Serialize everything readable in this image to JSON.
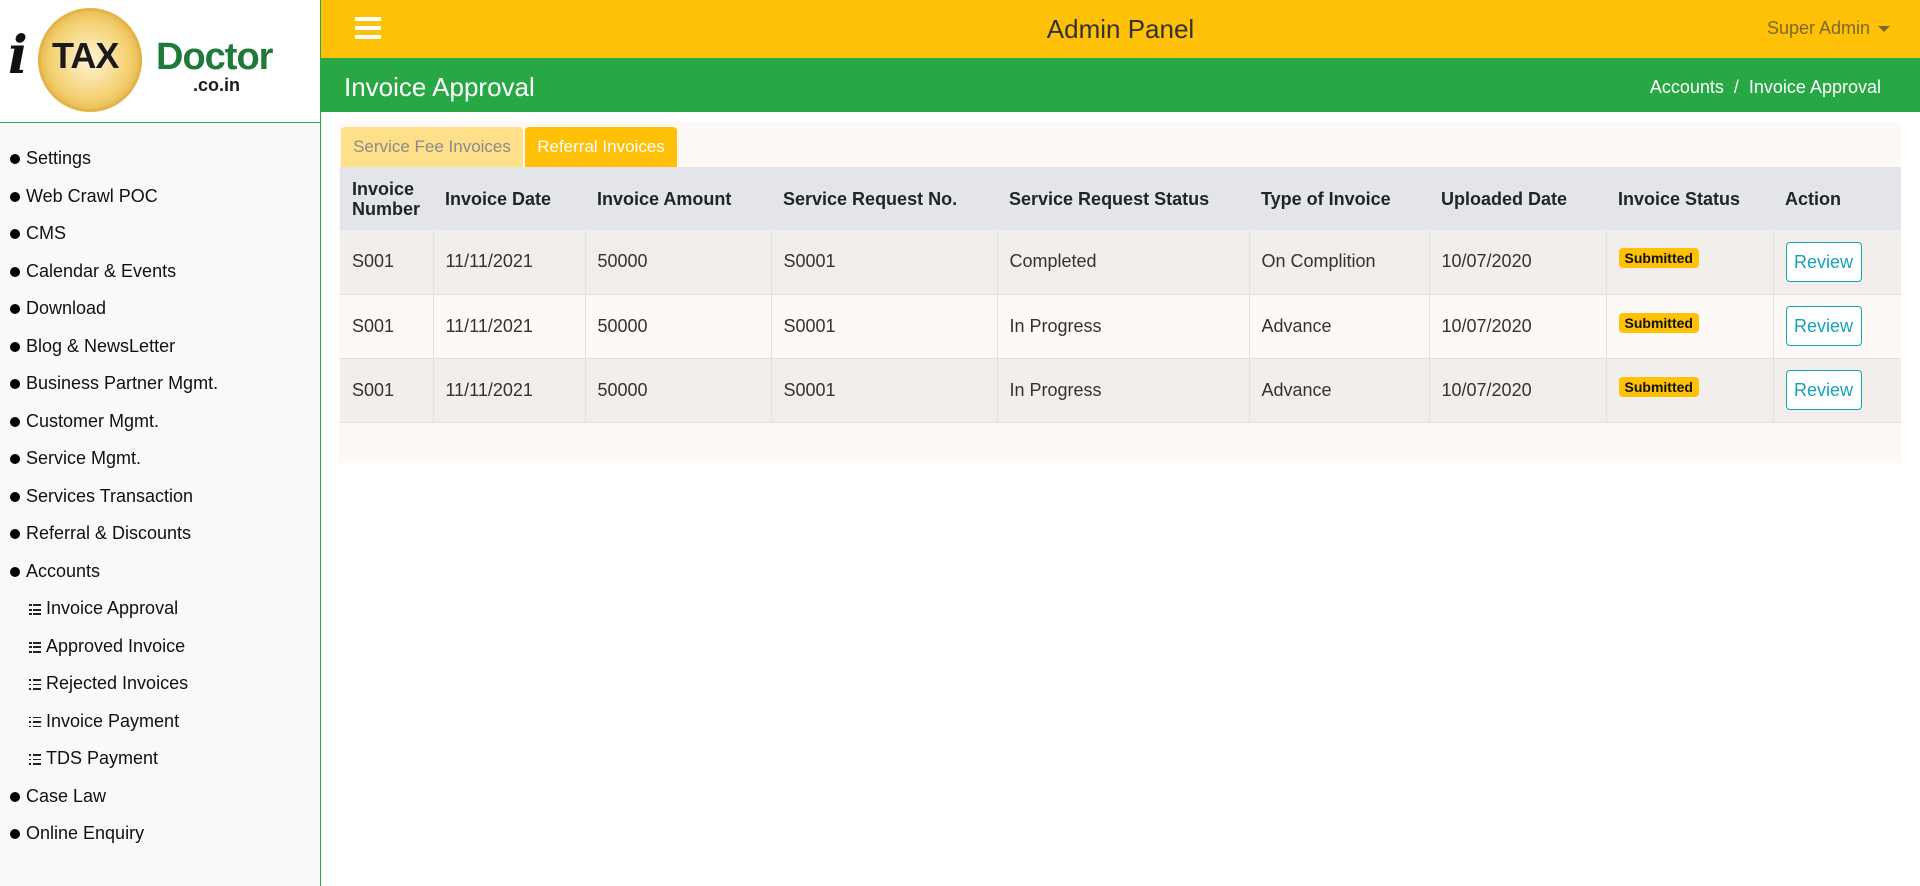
{
  "logo": {
    "i": "i",
    "tax": "TAX",
    "doctor": "Doctor",
    "domain": ".co.in"
  },
  "sidebar": {
    "items": [
      {
        "label": "Settings"
      },
      {
        "label": "Web Crawl POC"
      },
      {
        "label": "CMS"
      },
      {
        "label": "Calendar & Events"
      },
      {
        "label": "Download"
      },
      {
        "label": "Blog & NewsLetter"
      },
      {
        "label": "Business Partner Mgmt."
      },
      {
        "label": "Customer Mgmt."
      },
      {
        "label": "Service Mgmt."
      },
      {
        "label": "Services Transaction"
      },
      {
        "label": "Referral & Discounts"
      },
      {
        "label": "Accounts"
      }
    ],
    "accounts_sub": [
      {
        "label": "Invoice Approval"
      },
      {
        "label": "Approved Invoice"
      },
      {
        "label": "Rejected Invoices"
      },
      {
        "label": "Invoice Payment"
      },
      {
        "label": "TDS Payment"
      }
    ],
    "after_items": [
      {
        "label": "Case Law"
      },
      {
        "label": "Online Enquiry"
      }
    ]
  },
  "header": {
    "title": "Admin Panel",
    "user": "Super Admin"
  },
  "titlebar": {
    "title": "Invoice Approval",
    "breadcrumb": [
      "Accounts",
      "/",
      "Invoice Approval"
    ]
  },
  "tabs": [
    {
      "label": "Service Fee Invoices"
    },
    {
      "label": "Referral Invoices"
    }
  ],
  "table": {
    "headers": [
      "Invoice Number",
      "Invoice Date",
      "Invoice Amount",
      "Service Request No.",
      "Service Request Status",
      "Type of Invoice",
      "Uploaded Date",
      "Invoice Status",
      "Action"
    ],
    "rows": [
      {
        "number": "S001",
        "date": "11/11/2021",
        "amount": "50000",
        "sr_no": "S0001",
        "sr_status": "Completed",
        "type": "On Complition",
        "uploaded": "10/07/2020",
        "status": "Submitted",
        "action": "Review"
      },
      {
        "number": "S001",
        "date": "11/11/2021",
        "amount": "50000",
        "sr_no": "S0001",
        "sr_status": "In Progress",
        "type": "Advance",
        "uploaded": "10/07/2020",
        "status": "Submitted",
        "action": "Review"
      },
      {
        "number": "S001",
        "date": "11/11/2021",
        "amount": "50000",
        "sr_no": "S0001",
        "sr_status": "In Progress",
        "type": "Advance",
        "uploaded": "10/07/2020",
        "status": "Submitted",
        "action": "Review"
      }
    ]
  },
  "colors": {
    "header_yellow": "#ffc107",
    "title_green": "#28a745",
    "review_teal": "#17a2b8"
  }
}
